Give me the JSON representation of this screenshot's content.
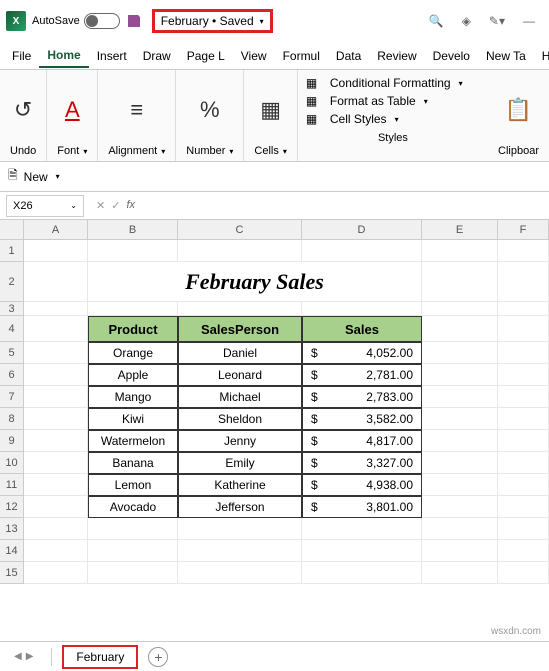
{
  "titlebar": {
    "autosave_label": "AutoSave",
    "filename": "February • Saved"
  },
  "menu": [
    "File",
    "Home",
    "Insert",
    "Draw",
    "Page L",
    "View",
    "Formul",
    "Data",
    "Review",
    "Develo",
    "New Ta",
    "Help"
  ],
  "ribbon": {
    "undo": "Undo",
    "font": "Font",
    "alignment": "Alignment",
    "number": "Number",
    "cells": "Cells",
    "cond_fmt": "Conditional Formatting",
    "fmt_table": "Format as Table",
    "cell_styles": "Cell Styles",
    "styles": "Styles",
    "clipboard": "Clipboar"
  },
  "toolbar": {
    "new": "New"
  },
  "namebox": "X26",
  "columns": [
    "A",
    "B",
    "C",
    "D",
    "E",
    "F"
  ],
  "sheet_title": "February Sales",
  "headers": {
    "product": "Product",
    "salesperson": "SalesPerson",
    "sales": "Sales"
  },
  "chart_data": {
    "type": "table",
    "title": "February Sales",
    "columns": [
      "Product",
      "SalesPerson",
      "Sales"
    ],
    "rows": [
      {
        "product": "Orange",
        "salesperson": "Daniel",
        "sales": 4052.0
      },
      {
        "product": "Apple",
        "salesperson": "Leonard",
        "sales": 2781.0
      },
      {
        "product": "Mango",
        "salesperson": "Michael",
        "sales": 2783.0
      },
      {
        "product": "Kiwi",
        "salesperson": "Sheldon",
        "sales": 3582.0
      },
      {
        "product": "Watermelon",
        "salesperson": "Jenny",
        "sales": 4817.0
      },
      {
        "product": "Banana",
        "salesperson": "Emily",
        "sales": 3327.0
      },
      {
        "product": "Lemon",
        "salesperson": "Katherine",
        "sales": 4938.0
      },
      {
        "product": "Avocado",
        "salesperson": "Jefferson",
        "sales": 3801.0
      }
    ]
  },
  "tab_name": "February",
  "watermark": "wsxdn.com"
}
